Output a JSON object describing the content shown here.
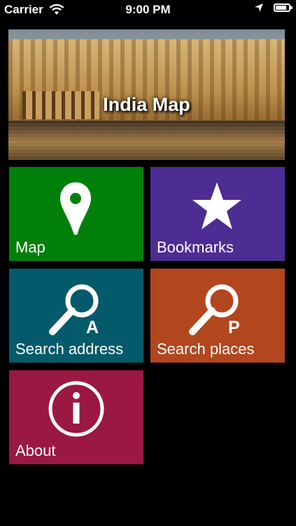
{
  "status_bar": {
    "carrier": "Carrier",
    "time": "9:00 PM",
    "battery_level": 0.85
  },
  "banner": {
    "title": "India Map"
  },
  "tiles": [
    {
      "label": "Map",
      "icon": "map-pin-icon",
      "color": "#00800b"
    },
    {
      "label": "Bookmarks",
      "icon": "star-icon",
      "color": "#4d2c93"
    },
    {
      "label": "Search address",
      "icon": "magnifier-a-icon",
      "letter": "A",
      "color": "#035a6a"
    },
    {
      "label": "Search places",
      "icon": "magnifier-p-icon",
      "letter": "P",
      "color": "#b2461f"
    },
    {
      "label": "About",
      "icon": "info-icon",
      "color": "#9a1841"
    }
  ]
}
